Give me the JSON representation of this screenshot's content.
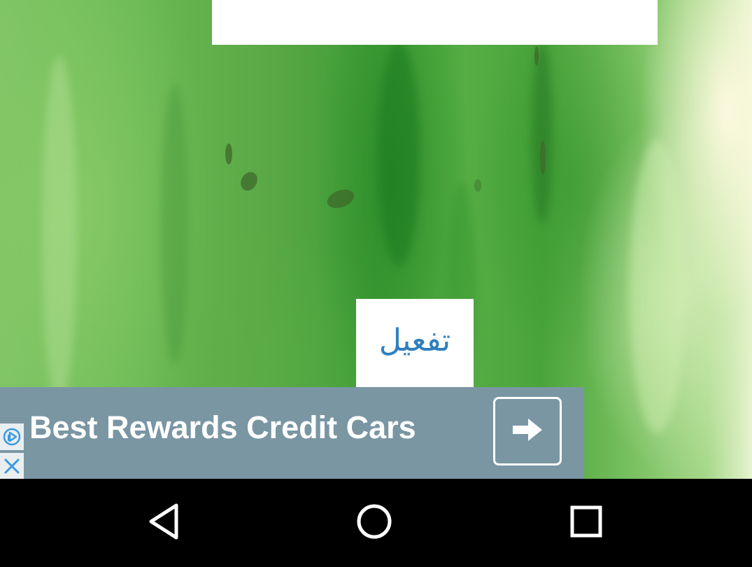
{
  "activate_button": {
    "label": "تفعيل",
    "color": "#2f7fbf"
  },
  "ad": {
    "headline": "Best Rewards Credit Cars",
    "background": "#7a96a3",
    "info_icon": "ad-choices-icon",
    "close_icon": "close-icon",
    "cta_icon": "arrow-right-icon"
  },
  "nav_bar": {
    "back_icon": "back-triangle-icon",
    "home_icon": "home-circle-icon",
    "recents_icon": "recents-square-icon"
  },
  "colors": {
    "accent_blue": "#2f7fbf",
    "ad_icon_blue": "#3b9ae1",
    "nav_background": "#000000"
  }
}
